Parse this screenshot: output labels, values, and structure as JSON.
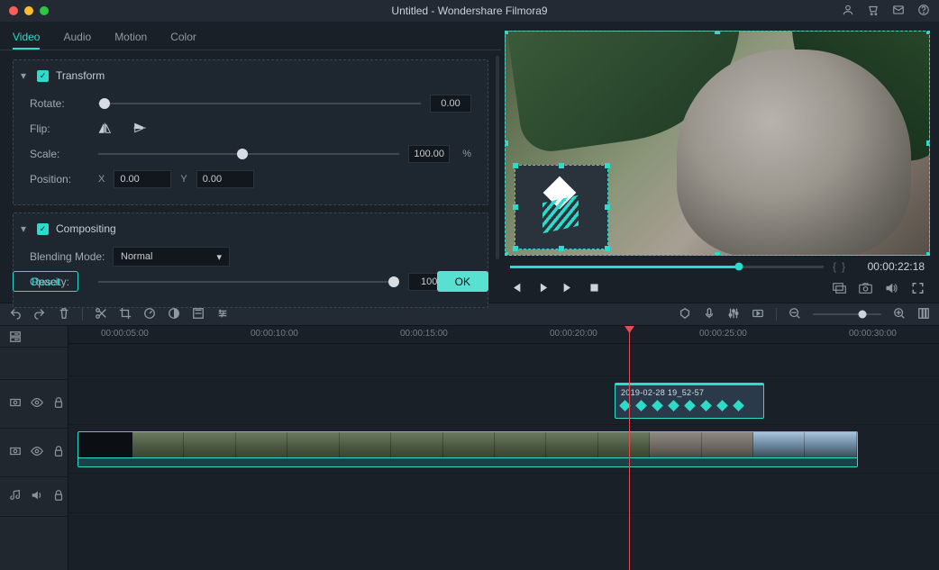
{
  "title": "Untitled - Wondershare Filmora9",
  "tabs": {
    "video": "Video",
    "audio": "Audio",
    "motion": "Motion",
    "color": "Color"
  },
  "transform": {
    "header": "Transform",
    "rotate_label": "Rotate:",
    "rotate_value": "0.00",
    "flip_label": "Flip:",
    "scale_label": "Scale:",
    "scale_value": "100.00",
    "position_label": "Position:",
    "pos_x_label": "X",
    "pos_x": "0.00",
    "pos_y_label": "Y",
    "pos_y": "0.00",
    "pct": "%"
  },
  "compositing": {
    "header": "Compositing",
    "blend_label": "Blending Mode:",
    "blend_value": "Normal",
    "opacity_label": "Opacity:",
    "opacity_value": "100",
    "pct": "%"
  },
  "buttons": {
    "reset": "Reset",
    "ok": "OK"
  },
  "preview": {
    "timecode": "00:00:22:18"
  },
  "timeline": {
    "ticks": [
      "00:00:05:00",
      "00:00:10:00",
      "00:00:15:00",
      "00:00:20:00",
      "00:00:25:00",
      "00:00:30:00"
    ],
    "clip1_label": "2019-02-28 19_52-57"
  }
}
